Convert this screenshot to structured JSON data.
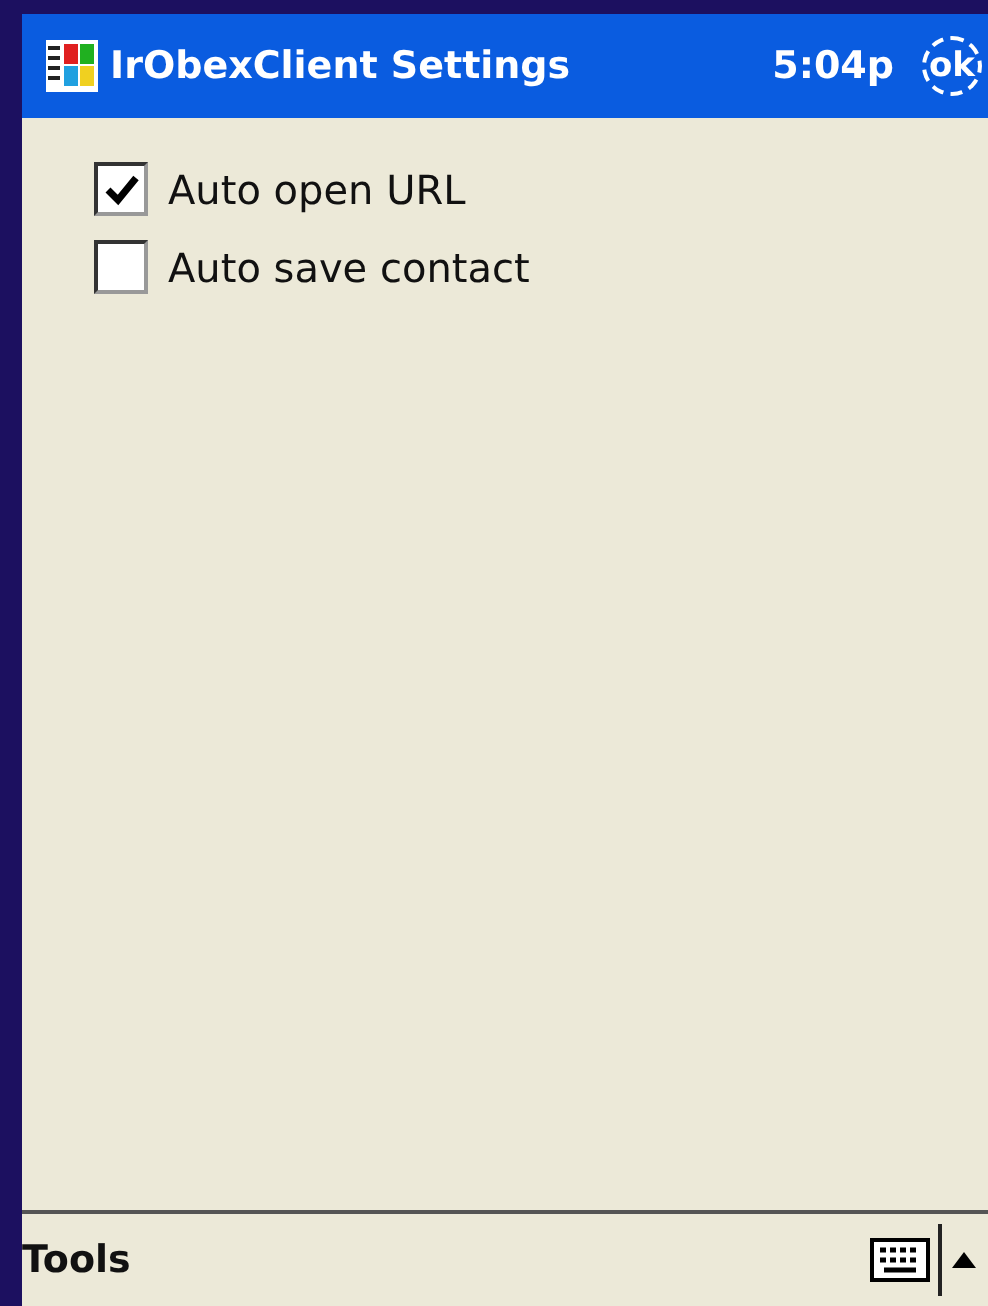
{
  "title_bar": {
    "title": "IrObexClient Settings",
    "time": "5:04p",
    "ok_label": "ok"
  },
  "options": [
    {
      "label": "Auto open URL",
      "checked": true
    },
    {
      "label": "Auto save contact",
      "checked": false
    }
  ],
  "menu_bar": {
    "items": [
      "Tools"
    ]
  }
}
